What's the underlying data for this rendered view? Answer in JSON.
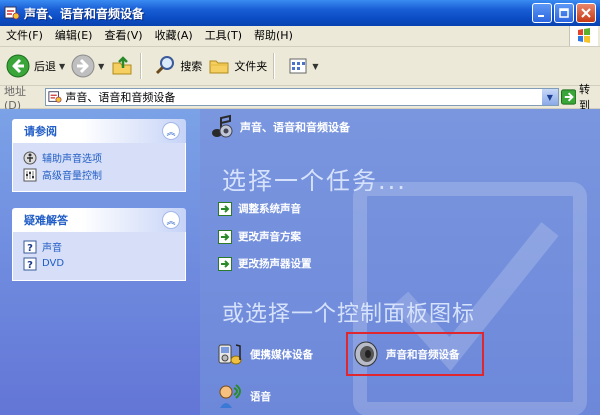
{
  "window": {
    "title": "声音、语音和音频设备"
  },
  "menu": {
    "items": [
      "文件(F)",
      "编辑(E)",
      "查看(V)",
      "收藏(A)",
      "工具(T)",
      "帮助(H)"
    ]
  },
  "toolbar": {
    "back_label": "后退",
    "search_label": "搜索",
    "folders_label": "文件夹"
  },
  "address": {
    "label": "地址(D)",
    "value": "声音、语音和音频设备",
    "go_label": "转到"
  },
  "left_panels": {
    "see_also": {
      "title": "请参阅",
      "links": [
        "辅助声音选项",
        "高级音量控制"
      ]
    },
    "troubleshoot": {
      "title": "疑难解答",
      "links": [
        "声音",
        "DVD"
      ]
    }
  },
  "main": {
    "header_title": "声音、语音和音频设备",
    "pick_task": "选择一个任务...",
    "tasks": [
      "调整系统声音",
      "更改声音方案",
      "更改扬声器设置"
    ],
    "or_pick": "或选择一个控制面板图标",
    "icons": {
      "portable": "便携媒体设备",
      "sound": "声音和音频设备",
      "speech": "语音"
    }
  },
  "colors": {
    "title_bar": "#0B4CC4",
    "content_bg": "#6D88D9",
    "link_blue": "#215DC6",
    "highlight_red": "#E0262E"
  }
}
